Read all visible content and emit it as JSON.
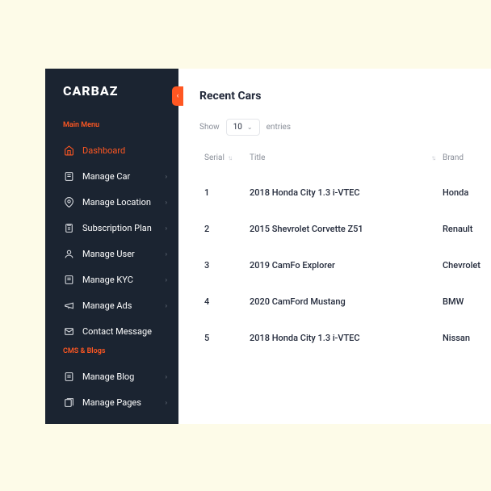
{
  "brand": "CARBAZ",
  "sidebar": {
    "section1_label": "Main Menu",
    "section2_label": "CMS & Blogs",
    "items1": [
      {
        "label": "Dashboard"
      },
      {
        "label": "Manage Car"
      },
      {
        "label": "Manage Location"
      },
      {
        "label": "Subscription Plan"
      },
      {
        "label": "Manage User"
      },
      {
        "label": "Manage KYC"
      },
      {
        "label": "Manage Ads"
      },
      {
        "label": "Contact Message"
      }
    ],
    "items2": [
      {
        "label": "Manage Blog"
      },
      {
        "label": "Manage Pages"
      }
    ]
  },
  "main": {
    "title": "Recent Cars",
    "show_label": "Show",
    "entries_label": "entries",
    "page_size": "10",
    "columns": {
      "serial": "Serial",
      "title": "Title",
      "brand": "Brand"
    },
    "rows": [
      {
        "serial": "1",
        "title": "2018 Honda City 1.3 i-VTEC",
        "brand": "Honda"
      },
      {
        "serial": "2",
        "title": "2015 Shevrolet Corvette Z51",
        "brand": "Renault"
      },
      {
        "serial": "3",
        "title": "2019 CamFo Explorer",
        "brand": "Chevrolet"
      },
      {
        "serial": "4",
        "title": "2020 CamFord Mustang",
        "brand": "BMW"
      },
      {
        "serial": "5",
        "title": "2018 Honda City 1.3 i-VTEC",
        "brand": "Nissan"
      }
    ]
  }
}
